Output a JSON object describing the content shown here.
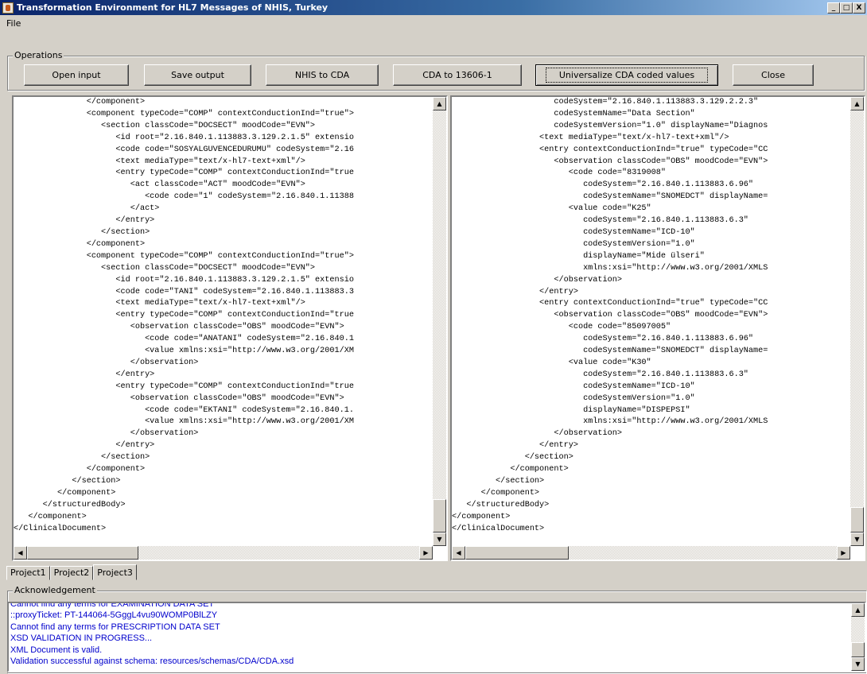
{
  "window": {
    "title": "Transformation Environment for HL7 Messages of NHIS, Turkey",
    "buttons": [
      "_",
      "□",
      "X"
    ]
  },
  "menu": {
    "items": [
      "File"
    ]
  },
  "operations": {
    "label": "Operations",
    "buttons": [
      "Open input",
      "Save output",
      "NHIS to CDA",
      "CDA to 13606-1",
      "Universalize CDA coded values",
      "Close"
    ]
  },
  "left_editor": {
    "lines": [
      "               </component>",
      "               <component typeCode=\"COMP\" contextConductionInd=\"true\">",
      "                  <section classCode=\"DOCSECT\" moodCode=\"EVN\">",
      "                     <id root=\"2.16.840.1.113883.3.129.2.1.5\" extensio",
      "                     <code code=\"SOSYALGUVENCEDURUMU\" codeSystem=\"2.16",
      "                     <text mediaType=\"text/x-hl7-text+xml\"/>",
      "                     <entry typeCode=\"COMP\" contextConductionInd=\"true",
      "                        <act classCode=\"ACT\" moodCode=\"EVN\">",
      "                           <code code=\"1\" codeSystem=\"2.16.840.1.11388",
      "                        </act>",
      "                     </entry>",
      "                  </section>",
      "               </component>",
      "               <component typeCode=\"COMP\" contextConductionInd=\"true\">",
      "                  <section classCode=\"DOCSECT\" moodCode=\"EVN\">",
      "                     <id root=\"2.16.840.1.113883.3.129.2.1.5\" extensio",
      "                     <code code=\"TANI\" codeSystem=\"2.16.840.1.113883.3",
      "                     <text mediaType=\"text/x-hl7-text+xml\"/>",
      "                     <entry typeCode=\"COMP\" contextConductionInd=\"true",
      "                        <observation classCode=\"OBS\" moodCode=\"EVN\">",
      "                           <code code=\"ANATANI\" codeSystem=\"2.16.840.1",
      "                           <value xmlns:xsi=\"http://www.w3.org/2001/XM",
      "                        </observation>",
      "                     </entry>",
      "                     <entry typeCode=\"COMP\" contextConductionInd=\"true",
      "                        <observation classCode=\"OBS\" moodCode=\"EVN\">",
      "                           <code code=\"EKTANI\" codeSystem=\"2.16.840.1.",
      "                           <value xmlns:xsi=\"http://www.w3.org/2001/XM",
      "                        </observation>",
      "                     </entry>",
      "                  </section>",
      "               </component>",
      "            </section>",
      "         </component>",
      "      </structuredBody>",
      "   </component>",
      "</ClinicalDocument>"
    ]
  },
  "right_editor": {
    "lines": [
      "                     codeSystem=\"2.16.840.1.113883.3.129.2.2.3\"",
      "                     codeSystemName=\"Data Section\"",
      "                     codeSystemVersion=\"1.0\" displayName=\"Diagnos",
      "                  <text mediaType=\"text/x-hl7-text+xml\"/>",
      "                  <entry contextConductionInd=\"true\" typeCode=\"CC",
      "                     <observation classCode=\"OBS\" moodCode=\"EVN\">",
      "                        <code code=\"8319008\"",
      "                           codeSystem=\"2.16.840.1.113883.6.96\"",
      "                           codeSystemName=\"SNOMEDCT\" displayName=",
      "                        <value code=\"K25\"",
      "                           codeSystem=\"2.16.840.1.113883.6.3\"",
      "                           codeSystemName=\"ICD-10\"",
      "                           codeSystemVersion=\"1.0\"",
      "                           displayName=\"Mide ülseri\"",
      "                           xmlns:xsi=\"http://www.w3.org/2001/XMLS",
      "                     </observation>",
      "                  </entry>",
      "                  <entry contextConductionInd=\"true\" typeCode=\"CC",
      "                     <observation classCode=\"OBS\" moodCode=\"EVN\">",
      "                        <code code=\"85097005\"",
      "                           codeSystem=\"2.16.840.1.113883.6.96\"",
      "                           codeSystemName=\"SNOMEDCT\" displayName=",
      "                        <value code=\"K30\"",
      "                           codeSystem=\"2.16.840.1.113883.6.3\"",
      "                           codeSystemName=\"ICD-10\"",
      "                           codeSystemVersion=\"1.0\"",
      "                           displayName=\"DISPEPSI\"",
      "                           xmlns:xsi=\"http://www.w3.org/2001/XMLS",
      "                     </observation>",
      "                  </entry>",
      "               </section>",
      "            </component>",
      "         </section>",
      "      </component>",
      "   </structuredBody>",
      "</component>",
      "</ClinicalDocument>"
    ]
  },
  "project_tabs": [
    "Project1",
    "Project2",
    "Project3"
  ],
  "acknowledgement": {
    "label": "Acknowledgement",
    "lines": [
      "Cannot find any terms for EXAMINATION DATA SET",
      "::proxyTicket: PT-144064-5GggL4vu90WOMP0BlLZY",
      "Cannot find any terms for PRESCRIPTION DATA SET",
      "XSD VALIDATION IN PROGRESS...",
      "XML Document is valid.",
      "Validation successful against schema: resources/schemas/CDA/CDA.xsd"
    ]
  }
}
